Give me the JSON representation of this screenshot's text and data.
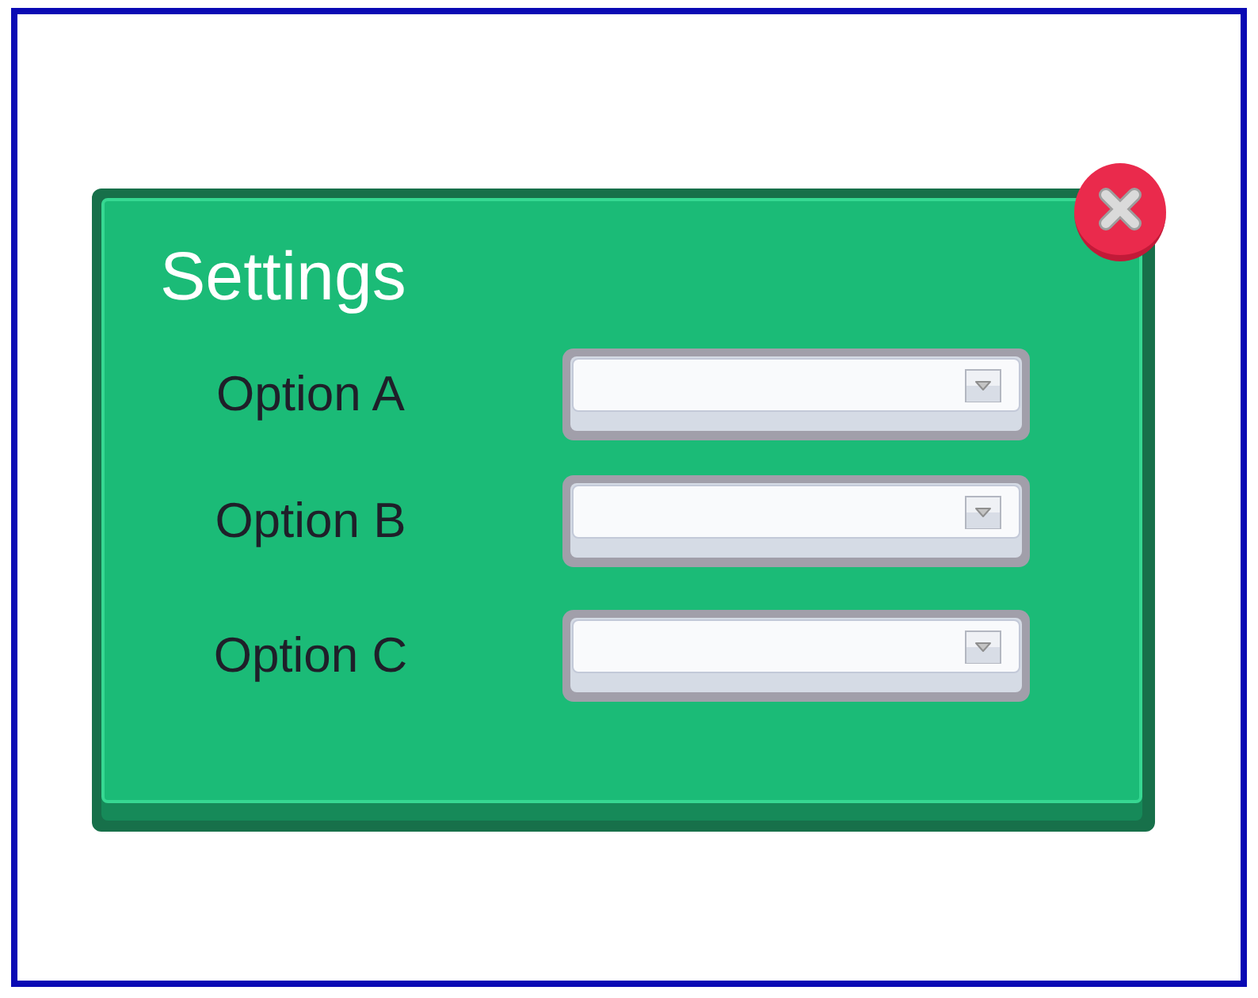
{
  "dialog": {
    "title": "Settings",
    "fields": [
      {
        "label": "Option A"
      },
      {
        "label": "Option B"
      },
      {
        "label": "Option C"
      }
    ]
  }
}
